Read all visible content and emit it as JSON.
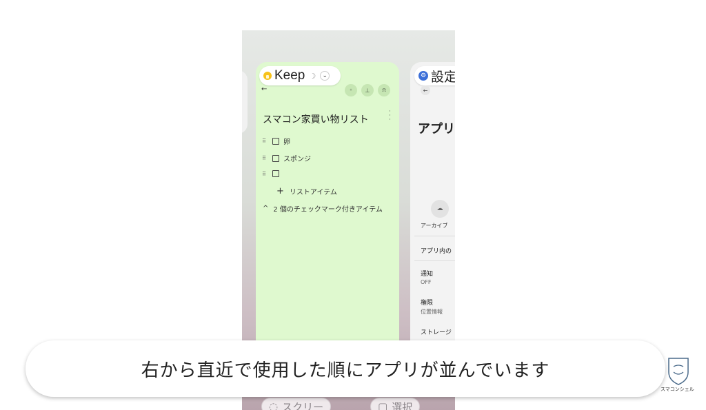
{
  "keep_card": {
    "app_name": "Keep",
    "app_name_extra": "☽",
    "note_title": "スマコン家買い物リスト",
    "items": [
      {
        "label": "卵"
      },
      {
        "label": "スポンジ"
      },
      {
        "label": ""
      }
    ],
    "add_item_label": "リストアイテム",
    "checked_items_label": "2 個のチェックマーク付きアイテム"
  },
  "settings_card": {
    "app_name": "設定",
    "heading": "アプリ",
    "archive_label": "アーカイブ",
    "rows": [
      {
        "title": "アプリ内の",
        "sub": ""
      },
      {
        "title": "通知",
        "sub": "OFF"
      },
      {
        "title": "権限",
        "sub": "位置情報"
      },
      {
        "title": "ストレージ",
        "sub": ""
      }
    ]
  },
  "bottom_buttons": {
    "screenshot_label": "スクリー",
    "select_label": "選択"
  },
  "caption": "右から直近で使用した順にアプリが並んでいます",
  "logo": {
    "text": "スマコンシェル"
  },
  "colors": {
    "keep_card_bg": "#dff9cf",
    "keep_bulb": "#f7c21a",
    "settings_gear": "#3c6fd8"
  }
}
